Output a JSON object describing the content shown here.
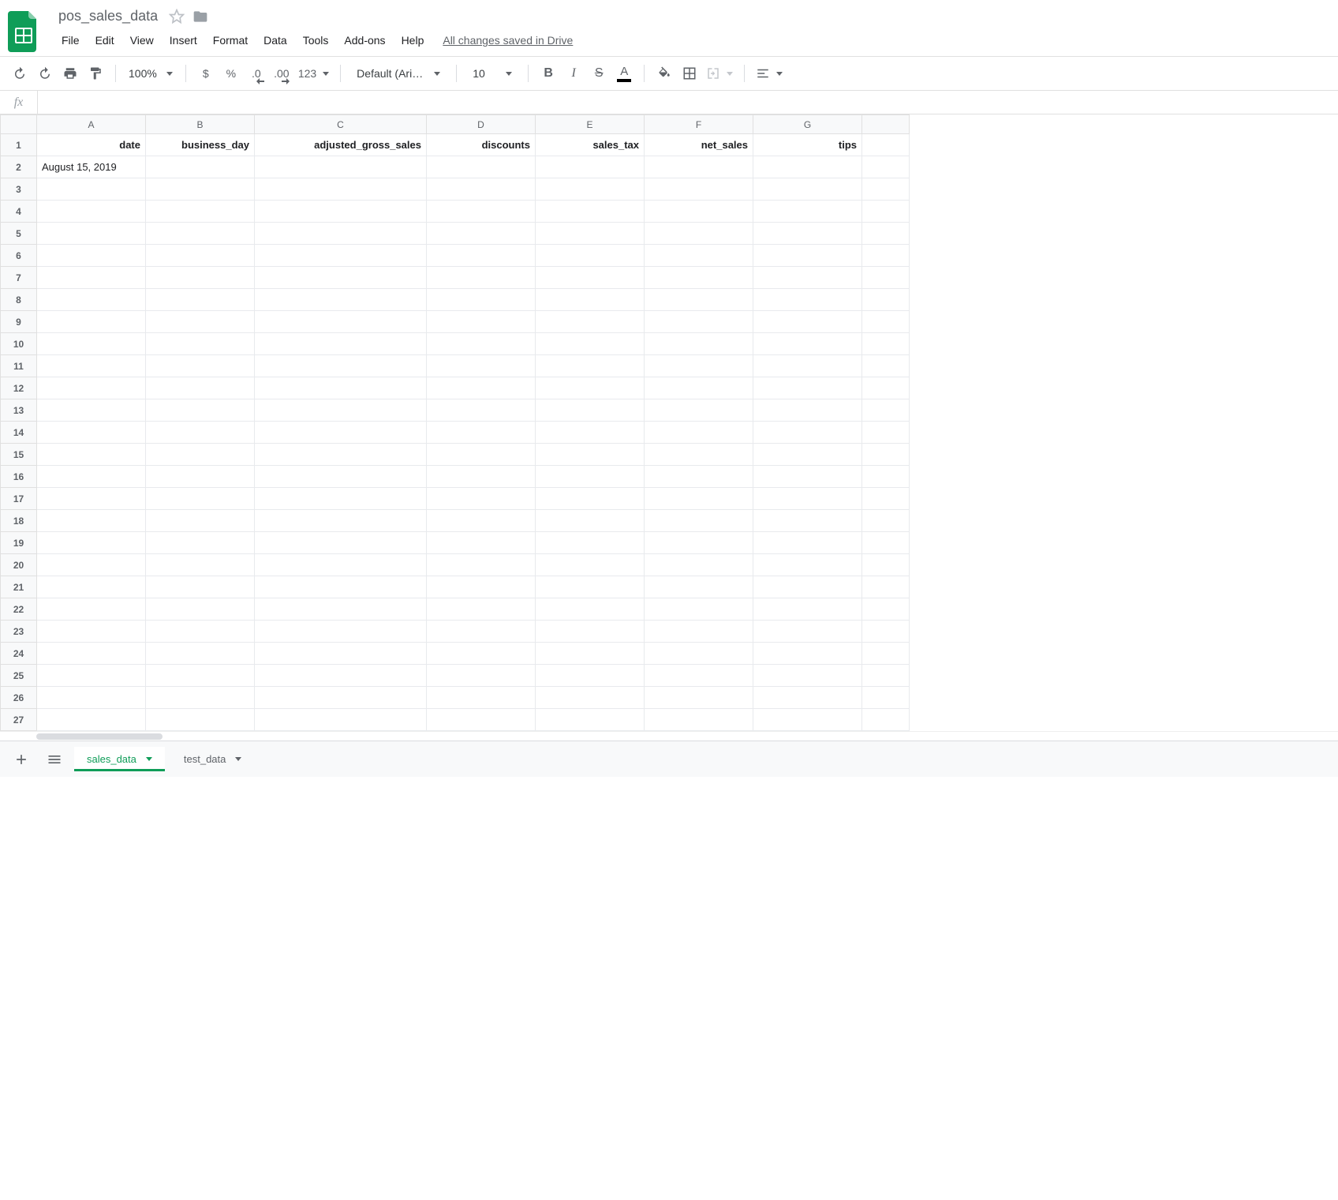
{
  "doc": {
    "title": "pos_sales_data"
  },
  "menu": {
    "file": "File",
    "edit": "Edit",
    "view": "View",
    "insert": "Insert",
    "format": "Format",
    "data": "Data",
    "tools": "Tools",
    "addons": "Add-ons",
    "help": "Help",
    "saved": "All changes saved in Drive"
  },
  "toolbar": {
    "zoom": "100%",
    "currency": "$",
    "percent": "%",
    "dec_dec": ".0",
    "inc_dec": ".00",
    "more_formats": "123",
    "font_name": "Default (Ari…",
    "font_size": "10",
    "bold": "B",
    "italic": "I",
    "strike": "S",
    "text_color": "A"
  },
  "formula_bar": {
    "fx": "fx",
    "value": ""
  },
  "columns": [
    "A",
    "B",
    "C",
    "D",
    "E",
    "F",
    "G"
  ],
  "headers": {
    "A": "date",
    "B": "business_day",
    "C": "adjusted_gross_sales",
    "D": "discounts",
    "E": "sales_tax",
    "F": "net_sales",
    "G": "tips"
  },
  "rows": {
    "2": {
      "A": "August 15, 2019"
    }
  },
  "row_count": 27,
  "sheets": {
    "active": "sales_data",
    "inactive": "test_data"
  }
}
